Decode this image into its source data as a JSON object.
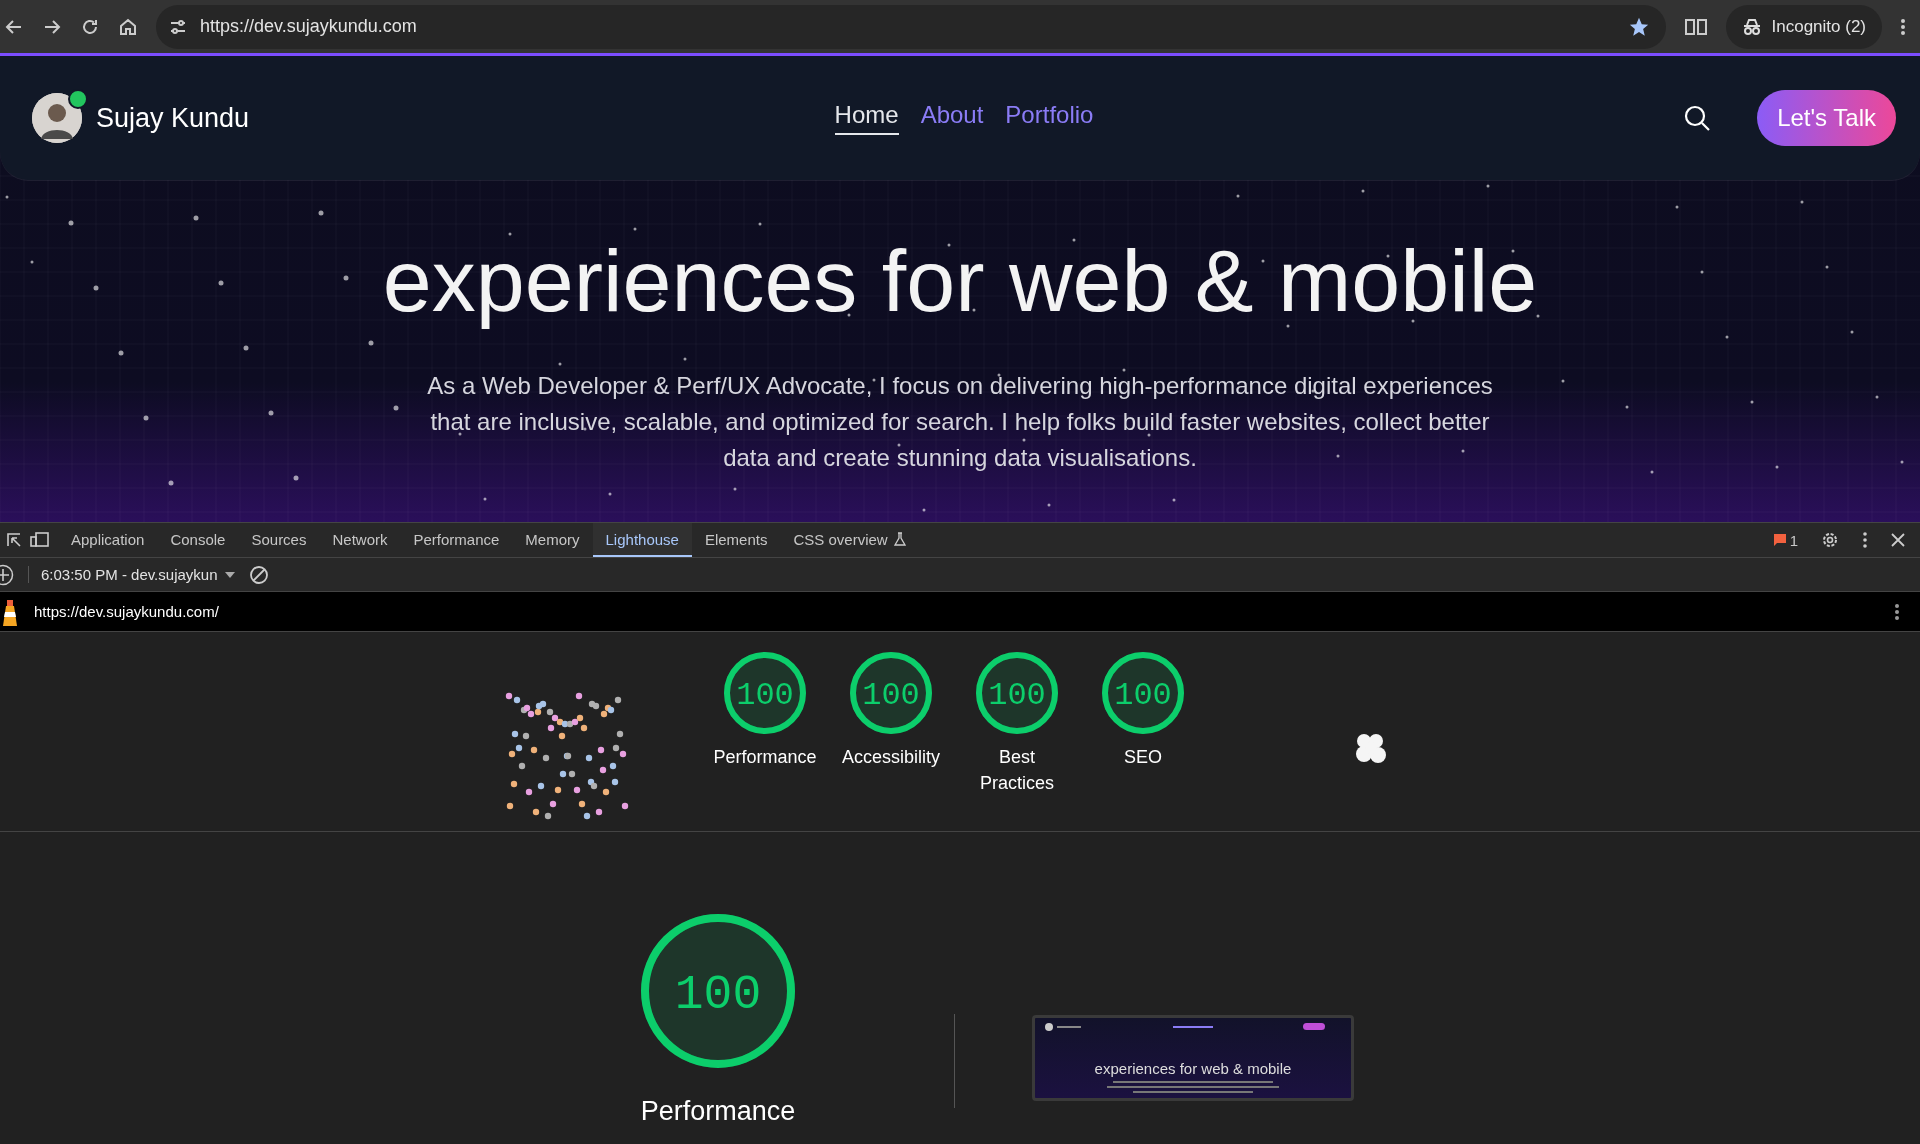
{
  "browser": {
    "url": "https://dev.sujaykundu.com",
    "profile": "Incognito (2)"
  },
  "site": {
    "name": "Sujay Kundu",
    "online": true,
    "nav": [
      {
        "label": "Home",
        "selected": true
      },
      {
        "label": "About",
        "selected": false
      },
      {
        "label": "Portfolio",
        "selected": false
      }
    ],
    "cta": "Let's Talk",
    "heading": "experiences for web & mobile",
    "intro": "As a Web Developer & Perf/UX Advocate, I focus on delivering high-performance digital experiences that are inclusive, scalable, and optimized for search. I help folks build faster websites, collect better data and create stunning data visualisations."
  },
  "devtools": {
    "tabs": [
      {
        "label": "Application",
        "selected": false,
        "experimental": false
      },
      {
        "label": "Console",
        "selected": false,
        "experimental": false
      },
      {
        "label": "Sources",
        "selected": false,
        "experimental": false
      },
      {
        "label": "Network",
        "selected": false,
        "experimental": false
      },
      {
        "label": "Performance",
        "selected": false,
        "experimental": false
      },
      {
        "label": "Memory",
        "selected": false,
        "experimental": false
      },
      {
        "label": "Lighthouse",
        "selected": true,
        "experimental": false
      },
      {
        "label": "Elements",
        "selected": false,
        "experimental": false
      },
      {
        "label": "CSS overview",
        "selected": false,
        "experimental": true
      }
    ],
    "issues": "1",
    "report": "6:03:50 PM - dev.sujaykun",
    "report_url": "https://dev.sujaykundu.com/",
    "scores": [
      {
        "score": "100",
        "label": "Performance",
        "level": 1
      },
      {
        "score": "100",
        "label": "Accessibility",
        "level": 1
      },
      {
        "score": "100",
        "label": "Best Practices",
        "level": 1
      },
      {
        "score": "100",
        "label": "SEO",
        "level": 1
      }
    ],
    "detail": {
      "score": "100",
      "label": "Performance",
      "level": 1
    },
    "thumbnail": {
      "heading": "experiences for web & mobile"
    }
  }
}
